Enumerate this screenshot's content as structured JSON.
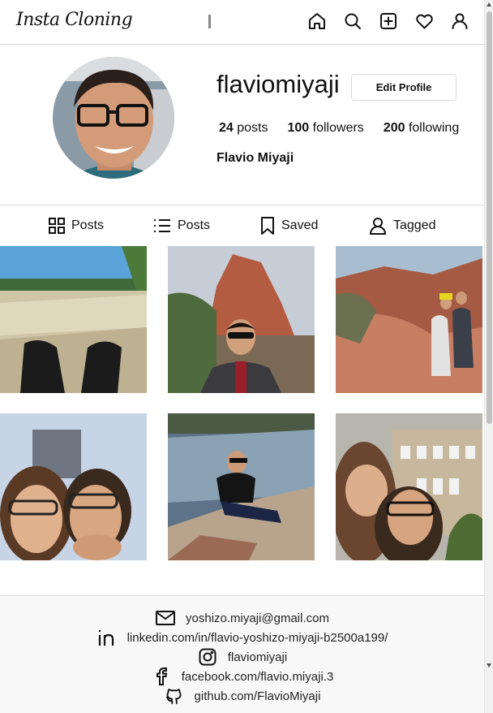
{
  "header": {
    "logo": "Insta Cloning",
    "nav_icons": [
      "home-icon",
      "search-icon",
      "new-post-icon",
      "heart-icon",
      "user-icon"
    ]
  },
  "profile": {
    "username": "flaviomiyaji",
    "edit_label": "Edit Profile",
    "posts_count": "24",
    "posts_label": "posts",
    "followers_count": "100",
    "followers_label": "followers",
    "following_count": "200",
    "following_label": "following",
    "full_name": "Flavio Miyaji"
  },
  "tabs": [
    {
      "label": "Posts",
      "icon": "grid-icon"
    },
    {
      "label": "Posts",
      "icon": "list-icon"
    },
    {
      "label": "Saved",
      "icon": "bookmark-icon"
    },
    {
      "label": "Tagged",
      "icon": "user-tag-icon"
    }
  ],
  "footer": {
    "email": "yoshizo.miyaji@gmail.com",
    "linkedin": "linkedin.com/in/flavio-yoshizo-miyaji-b2500a199/",
    "instagram": "flaviomiyaji",
    "facebook": "facebook.com/flavio.miyaji.3",
    "github": "github.com/FlavioMiyaji"
  }
}
